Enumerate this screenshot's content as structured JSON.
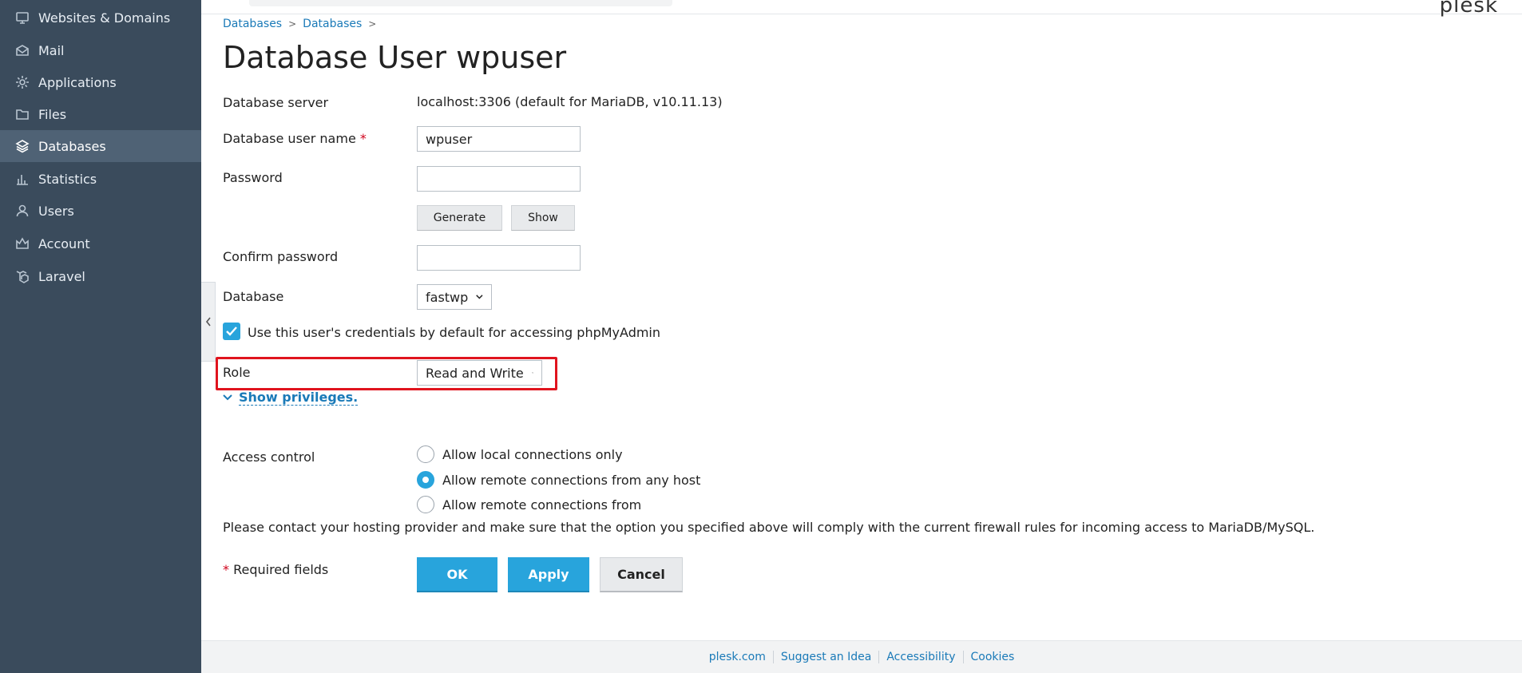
{
  "sidebar": {
    "items": [
      {
        "label": "Websites & Domains",
        "icon": "monitor-icon"
      },
      {
        "label": "Mail",
        "icon": "mail-icon"
      },
      {
        "label": "Applications",
        "icon": "gear-icon"
      },
      {
        "label": "Files",
        "icon": "folder-icon"
      },
      {
        "label": "Databases",
        "icon": "layers-icon",
        "active": true
      },
      {
        "label": "Statistics",
        "icon": "bar-chart-icon"
      },
      {
        "label": "Users",
        "icon": "user-icon"
      },
      {
        "label": "Account",
        "icon": "crown-icon"
      },
      {
        "label": "Laravel",
        "icon": "laravel-icon"
      }
    ]
  },
  "header": {
    "logo": "plesk"
  },
  "breadcrumb": [
    "Databases",
    "Databases"
  ],
  "page": {
    "title": "Database User wpuser"
  },
  "form": {
    "server_label": "Database server",
    "server_value": "localhost:3306 (default for MariaDB, v10.11.13)",
    "username_label": "Database user name",
    "required_mark": "*",
    "username_value": "wpuser",
    "password_label": "Password",
    "password_value": "",
    "generate_label": "Generate",
    "show_label": "Show",
    "confirm_label": "Confirm password",
    "confirm_value": "",
    "database_label": "Database",
    "database_value": "fastwp",
    "phpmyadmin_label": "Use this user's credentials by default for accessing phpMyAdmin",
    "phpmyadmin_checked": true,
    "role_label": "Role",
    "role_value": "Read and Write",
    "show_privileges": "Show privileges.",
    "access_label": "Access control",
    "access_options": [
      "Allow local connections only",
      "Allow remote connections from any host",
      "Allow remote connections from"
    ],
    "access_selected": 1,
    "note": "Please contact your hosting provider and make sure that the option you specified above will comply with the current firewall rules for incoming access to MariaDB/MySQL.",
    "required_fields": "Required fields",
    "ok_label": "OK",
    "apply_label": "Apply",
    "cancel_label": "Cancel"
  },
  "footer": {
    "links": [
      "plesk.com",
      "Suggest an Idea",
      "Accessibility",
      "Cookies"
    ]
  },
  "colors": {
    "sidebar_bg": "#3a4b5c",
    "accent": "#28a4dc",
    "link": "#1a7ab8",
    "highlight": "#e0141e"
  }
}
